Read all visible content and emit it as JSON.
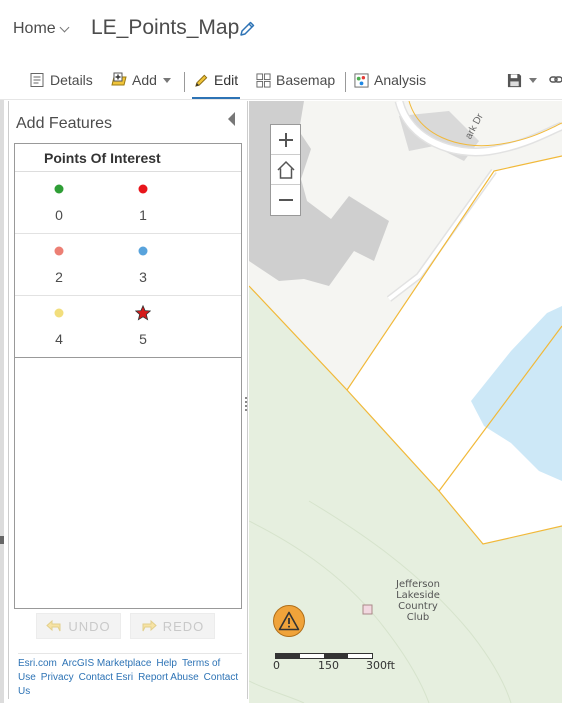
{
  "header": {
    "home_label": "Home",
    "map_title": "LE_Points_Map"
  },
  "toolbar": {
    "details": "Details",
    "add": "Add",
    "edit": "Edit",
    "basemap": "Basemap",
    "analysis": "Analysis"
  },
  "panel": {
    "title": "Add Features",
    "layer_name": "Points Of Interest",
    "templates": [
      {
        "label": "0",
        "symbol": "dot",
        "color": "#2f9e36"
      },
      {
        "label": "1",
        "symbol": "dot",
        "color": "#e8151b"
      },
      {
        "label": "2",
        "symbol": "dot",
        "color": "#ec7f74"
      },
      {
        "label": "3",
        "symbol": "dot",
        "color": "#58a3dc"
      },
      {
        "label": "4",
        "symbol": "dot",
        "color": "#f2de7c"
      },
      {
        "label": "5",
        "symbol": "star",
        "color": "#d51b1b"
      }
    ],
    "undo_label": "UNDO",
    "redo_label": "REDO"
  },
  "footer": {
    "links": [
      "Esri.com",
      "ArcGIS Marketplace",
      "Help",
      "Terms of Use",
      "Privacy",
      "Contact Esri",
      "Report Abuse",
      "Contact Us"
    ]
  },
  "map": {
    "street_label": "ark Dr",
    "place_label": "Jefferson Lakeside Country Club",
    "scale_labels": [
      "0",
      "150",
      "300ft"
    ]
  },
  "colors": {
    "accent": "#2d73b5",
    "parcel_line": "#f1b93a",
    "water": "#cde8f7",
    "park": "#e6efdf",
    "building": "#cfcfcf",
    "warning": "#f0a33a"
  }
}
